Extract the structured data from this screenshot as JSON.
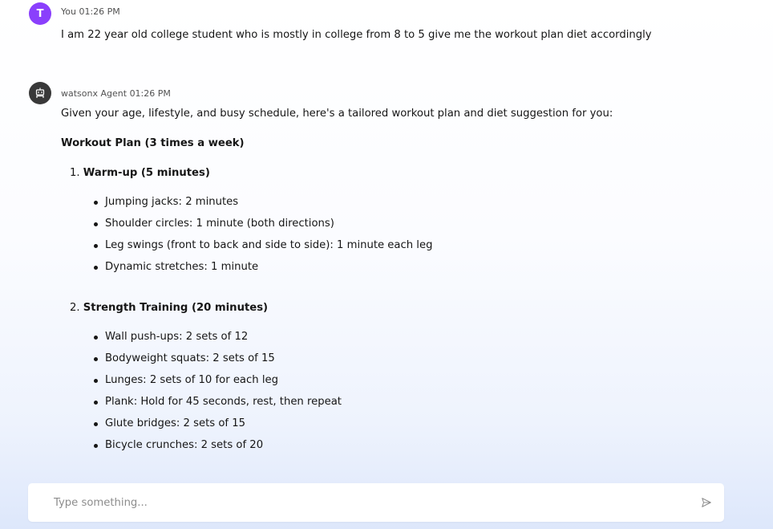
{
  "user_message": {
    "avatar_initial": "T",
    "sender": "You",
    "time": "01:26 PM",
    "text": "I am 22 year old college student who is mostly in college from 8 to 5 give me the workout plan diet accordingly"
  },
  "agent_message": {
    "sender": "watsonx Agent",
    "time": "01:26 PM",
    "intro": "Given your age, lifestyle, and busy schedule, here's a tailored workout plan and diet suggestion for you:",
    "plan_title": "Workout Plan (3 times a week)",
    "sections": [
      {
        "number": "1.",
        "title": "Warm-up (5 minutes)",
        "items": [
          "Jumping jacks: 2 minutes",
          "Shoulder circles: 1 minute (both directions)",
          "Leg swings (front to back and side to side): 1 minute each leg",
          "Dynamic stretches: 1 minute"
        ]
      },
      {
        "number": "2.",
        "title": "Strength Training (20 minutes)",
        "items": [
          "Wall push-ups: 2 sets of 12",
          "Bodyweight squats: 2 sets of 15",
          "Lunges: 2 sets of 10 for each leg",
          "Plank: Hold for 45 seconds, rest, then repeat",
          "Glute bridges: 2 sets of 15",
          "Bicycle crunches: 2 sets of 20"
        ]
      }
    ]
  },
  "composer": {
    "placeholder": "Type something...",
    "value": "",
    "send_icon": "send-icon"
  },
  "colors": {
    "user_avatar": "#8a3ffc",
    "agent_avatar": "#393939",
    "muted_text": "#525252",
    "placeholder": "#8d8d8d"
  }
}
